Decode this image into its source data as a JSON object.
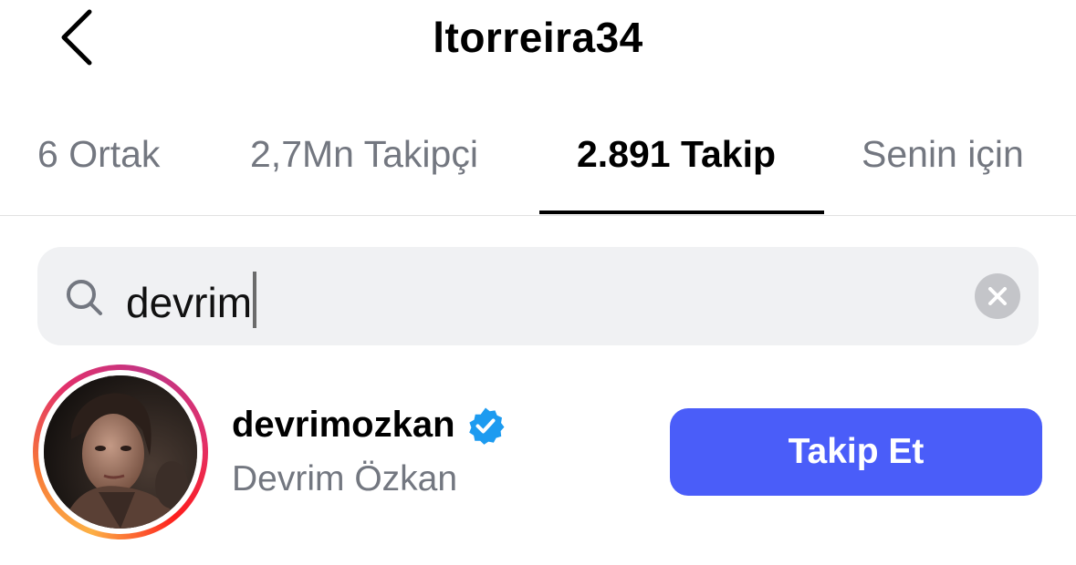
{
  "header": {
    "title": "ltorreira34",
    "back_icon": "chevron-left-icon"
  },
  "tabs": [
    {
      "label": "6 Ortak",
      "active": false
    },
    {
      "label": "2,7Mn Takipçi",
      "active": false
    },
    {
      "label": "2.891 Takip",
      "active": true
    },
    {
      "label": "Senin için",
      "active": false
    }
  ],
  "search": {
    "icon": "search-icon",
    "value": "devrim",
    "clear_icon": "close-icon"
  },
  "results": [
    {
      "username": "devrimozkan",
      "verified": true,
      "full_name": "Devrim Özkan",
      "has_story_ring": true,
      "button_label": "Takip Et"
    }
  ],
  "colors": {
    "primary_button": "#4a5df9",
    "verified_badge": "#1d9bf0",
    "secondary_text": "#737780",
    "search_background": "#f0f1f3"
  }
}
